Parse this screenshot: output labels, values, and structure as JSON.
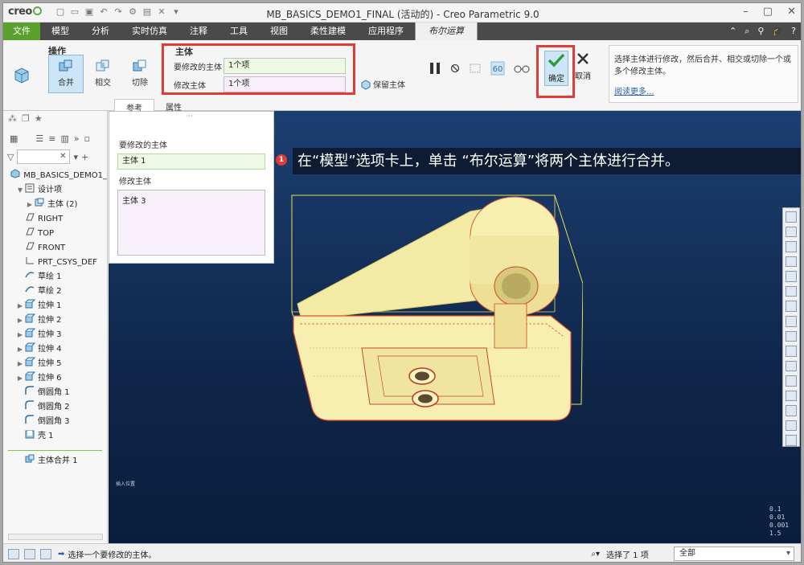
{
  "app": {
    "logo": "creo",
    "window_title": "MB_BASICS_DEMO1_FINAL (活动的) - Creo Parametric 9.0"
  },
  "ribbon_tabs": [
    {
      "label": "文件",
      "id": "file"
    },
    {
      "label": "模型",
      "id": "model"
    },
    {
      "label": "分析",
      "id": "analysis"
    },
    {
      "label": "实时仿真",
      "id": "simulate"
    },
    {
      "label": "注释",
      "id": "annotate"
    },
    {
      "label": "工具",
      "id": "tools"
    },
    {
      "label": "视图",
      "id": "view"
    },
    {
      "label": "柔性建模",
      "id": "flex"
    },
    {
      "label": "应用程序",
      "id": "apps"
    },
    {
      "label": "布尔运算",
      "id": "boolean"
    }
  ],
  "ribbon": {
    "operations_title": "操作",
    "operations": [
      {
        "label": "合并",
        "selected": true
      },
      {
        "label": "相交",
        "selected": false
      },
      {
        "label": "切除",
        "selected": false
      }
    ],
    "bodies_title": "主体",
    "body_to_modify_label": "要修改的主体",
    "body_to_modify_value": "1个项",
    "modifying_body_label": "修改主体",
    "modifying_body_value": "1个项",
    "keep_body_label": "保留主体",
    "ok_label": "确定",
    "cancel_label": "取消",
    "help_text": "选择主体进行修改，然后合并、相交或切除一个或多个修改主体。",
    "help_link": "阅读更多..."
  },
  "subtabs": [
    "参考",
    "属性"
  ],
  "model_tree": {
    "root": "MB_BASICS_DEMO1_",
    "items": [
      {
        "label": "设计项",
        "expand": "open",
        "indent": 1,
        "icon": "design-items-icon"
      },
      {
        "label": "主体 (2)",
        "expand": "closed",
        "indent": 2,
        "icon": "body-icon"
      },
      {
        "label": "RIGHT",
        "expand": "",
        "indent": 1,
        "icon": "datum-plane-icon"
      },
      {
        "label": "TOP",
        "expand": "",
        "indent": 1,
        "icon": "datum-plane-icon"
      },
      {
        "label": "FRONT",
        "expand": "",
        "indent": 1,
        "icon": "datum-plane-icon"
      },
      {
        "label": "PRT_CSYS_DEF",
        "expand": "",
        "indent": 1,
        "icon": "csys-icon"
      },
      {
        "label": "草绘 1",
        "expand": "",
        "indent": 1,
        "icon": "sketch-icon"
      },
      {
        "label": "草绘 2",
        "expand": "",
        "indent": 1,
        "icon": "sketch-icon"
      },
      {
        "label": "拉伸 1",
        "expand": "closed",
        "indent": 1,
        "icon": "extrude-icon"
      },
      {
        "label": "拉伸 2",
        "expand": "closed",
        "indent": 1,
        "icon": "extrude-icon"
      },
      {
        "label": "拉伸 3",
        "expand": "closed",
        "indent": 1,
        "icon": "extrude-icon"
      },
      {
        "label": "拉伸 4",
        "expand": "closed",
        "indent": 1,
        "icon": "extrude-icon"
      },
      {
        "label": "拉伸 5",
        "expand": "closed",
        "indent": 1,
        "icon": "extrude-icon"
      },
      {
        "label": "拉伸 6",
        "expand": "closed",
        "indent": 1,
        "icon": "extrude-icon"
      },
      {
        "label": "倒圆角 1",
        "expand": "",
        "indent": 1,
        "icon": "round-icon"
      },
      {
        "label": "倒圆角 2",
        "expand": "",
        "indent": 1,
        "icon": "round-icon"
      },
      {
        "label": "倒圆角 3",
        "expand": "",
        "indent": 1,
        "icon": "round-icon"
      },
      {
        "label": "壳 1",
        "expand": "",
        "indent": 1,
        "icon": "shell-icon"
      }
    ],
    "inserted_item": "主体合并 1"
  },
  "ref_panel": {
    "body_to_modify_label": "要修改的主体",
    "body_to_modify_item": "主体 1",
    "modifying_body_label": "修改主体",
    "modifying_body_item": "主体 3"
  },
  "annotation": {
    "step_number": "1",
    "text": "在“模型”选项卡上，单击 “布尔运算”将两个主体进行合并。"
  },
  "viewport": {
    "insert_marker_text": "插入位置",
    "scale_lines": [
      "0.1",
      "0.01",
      "0.001",
      "1.5"
    ]
  },
  "statusbar": {
    "message": "选择一个要修改的主体。",
    "selection": "选择了 1 项",
    "filter": "全部"
  },
  "colors": {
    "file_tab": "#5aa02c",
    "ribbon_dark": "#4a4a4a",
    "highlight_red": "#e23b36",
    "viewport_top": "#1c3f72",
    "model_fill": "#f6efb0",
    "model_edge_yellow": "#e8e050",
    "model_edge_red": "#e05030"
  }
}
